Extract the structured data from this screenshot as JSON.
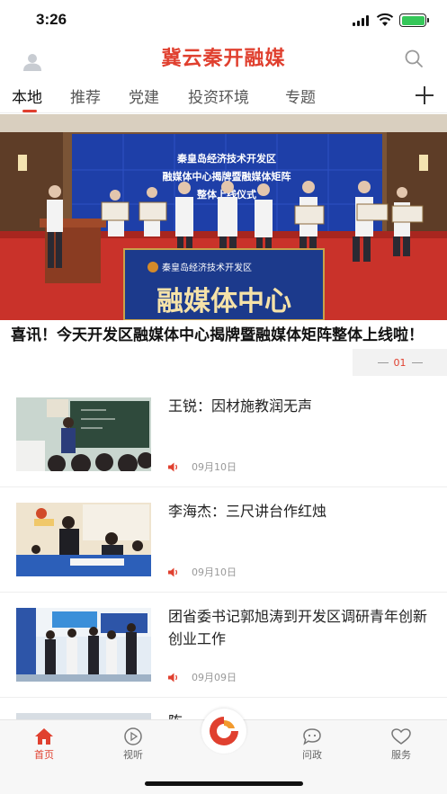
{
  "status": {
    "time": "3:26"
  },
  "header": {
    "title": "冀云秦开融媒"
  },
  "tabs": [
    "本地",
    "推荐",
    "党建",
    "投资环境",
    "专题"
  ],
  "banner": {
    "sign_lines": [
      "秦皇岛经济技术开发区",
      "融媒体中心揭牌暨融媒体矩阵",
      "整体上线仪式"
    ],
    "podium_top": "秦皇岛经济技术开发区",
    "podium_main": "融媒体中心",
    "headline": "喜讯！今天开发区融媒体中心揭牌暨融媒体矩阵整体上线啦！",
    "slide_index": "01"
  },
  "news": [
    {
      "title": "王锐：因材施教润无声",
      "date": "09月10日"
    },
    {
      "title": "李海杰：三尺讲台作红烛",
      "date": "09月10日"
    },
    {
      "title": "团省委书记郭旭涛到开发区调研青年创新创业工作",
      "date": "09月09日"
    },
    {
      "title": "陈…",
      "date": ""
    }
  ],
  "tabbar": [
    {
      "label": "首页",
      "icon": "home-icon"
    },
    {
      "label": "视听",
      "icon": "play-icon"
    },
    {
      "label": "问政",
      "icon": "chat-icon"
    },
    {
      "label": "服务",
      "icon": "heart-icon"
    }
  ],
  "colors": {
    "accent": "#e0402f"
  }
}
